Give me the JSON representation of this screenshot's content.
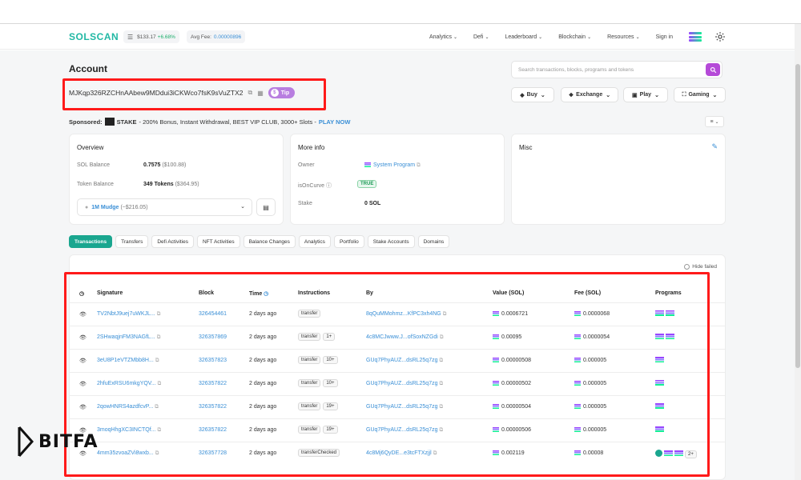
{
  "header": {
    "logo_text": "SOLSCAN",
    "sol_price": "$133.17",
    "sol_change": "+6.68%",
    "avg_fee_label": "Avg Fee:",
    "avg_fee_value": "0.00000896",
    "nav": [
      "Analytics",
      "Defi",
      "Leaderboard",
      "Blockchain",
      "Resources"
    ],
    "signin": "Sign in"
  },
  "page": {
    "title": "Account",
    "address": "MJKqp326RZCHnAAbew9MDdui3iCKWco7fsK9sVuZTX2",
    "tip_label": "Tip",
    "search_placeholder": "Search transactions, blocks, programs and tokens",
    "actions": [
      "Buy",
      "Exchange",
      "Play",
      "Gaming"
    ]
  },
  "sponsored": {
    "label": "Sponsored:",
    "brand": "STAKE",
    "text": "- 200% Bonus, Instant Withdrawal, BEST VIP CLUB, 3000+ Slots -",
    "cta": "PLAY NOW"
  },
  "overview": {
    "title": "Overview",
    "sol_balance_label": "SOL Balance",
    "sol_balance_value": "0.7575",
    "sol_balance_usd": "($100.88)",
    "token_balance_label": "Token Balance",
    "token_balance_value": "349 Tokens",
    "token_balance_usd": "($364.95)",
    "token_select_name": "1M Mudge",
    "token_select_usd": "(~$216.05)"
  },
  "more_info": {
    "title": "More info",
    "owner_label": "Owner",
    "owner_value": "System Program",
    "on_curve_label": "isOnCurve",
    "on_curve_value": "TRUE",
    "stake_label": "Stake",
    "stake_value": "0 SOL"
  },
  "misc": {
    "title": "Misc"
  },
  "tabs": [
    "Transactions",
    "Transfers",
    "Defi Activities",
    "NFT Activities",
    "Balance Changes",
    "Analytics",
    "Portfolio",
    "Stake Accounts",
    "Domains"
  ],
  "table": {
    "hide_failed": "Hide failed",
    "columns": [
      "Signature",
      "Block",
      "Time",
      "Instructions",
      "By",
      "Value (SOL)",
      "Fee (SOL)",
      "Programs"
    ],
    "rows": [
      {
        "sig": "TV2NbtJ9uej7uWKJL...",
        "block": "326454461",
        "time": "2 days ago",
        "instr": "transfer",
        "extra": "",
        "by": "8qQuMMohmz...KfPC3xh4NG",
        "value": "0.0006721",
        "fee": "0.0000068",
        "programs": 2
      },
      {
        "sig": "2SHwaqjnFM3NAGfL...",
        "block": "326357869",
        "time": "2 days ago",
        "instr": "transfer",
        "extra": "1+",
        "by": "4c8MCJwww.J...ofSoxNZGdi",
        "value": "0.00095",
        "fee": "0.0000054",
        "programs": 2
      },
      {
        "sig": "3eU8P1eVTZMbb8H...",
        "block": "326357823",
        "time": "2 days ago",
        "instr": "transfer",
        "extra": "10+",
        "by": "GUq7PhyAUZ...dsRL25q7zg",
        "value": "0.00000508",
        "fee": "0.000005",
        "programs": 1
      },
      {
        "sig": "2hfuExRSU6mkgYQV...",
        "block": "326357822",
        "time": "2 days ago",
        "instr": "transfer",
        "extra": "10+",
        "by": "GUq7PhyAUZ...dsRL25q7zg",
        "value": "0.00000502",
        "fee": "0.000005",
        "programs": 1
      },
      {
        "sig": "2qowHNRS4azdfcvP...",
        "block": "326357822",
        "time": "2 days ago",
        "instr": "transfer",
        "extra": "19+",
        "by": "GUq7PhyAUZ...dsRL25q7zg",
        "value": "0.00000504",
        "fee": "0.000005",
        "programs": 1
      },
      {
        "sig": "3moqHhgXC3INCTQf...",
        "block": "326357822",
        "time": "2 days ago",
        "instr": "transfer",
        "extra": "19+",
        "by": "GUq7PhyAUZ...dsRL25q7zg",
        "value": "0.00000506",
        "fee": "0.000005",
        "programs": 1
      },
      {
        "sig": "4mm35zvoaZVi8wxb...",
        "block": "326357728",
        "time": "2 days ago",
        "instr": "transferChecked",
        "extra": "",
        "by": "4c8Mj6QyDE...e3tcFTXzjjl",
        "value": "0.002119",
        "fee": "0.00008",
        "programs": 3,
        "more": "2+"
      }
    ]
  },
  "watermark": "BITFA",
  "colors": {
    "brand": "#1aa68f",
    "highlight": "#ff1a1a",
    "link": "#3a8fd6",
    "tip": "#b87ee0"
  }
}
